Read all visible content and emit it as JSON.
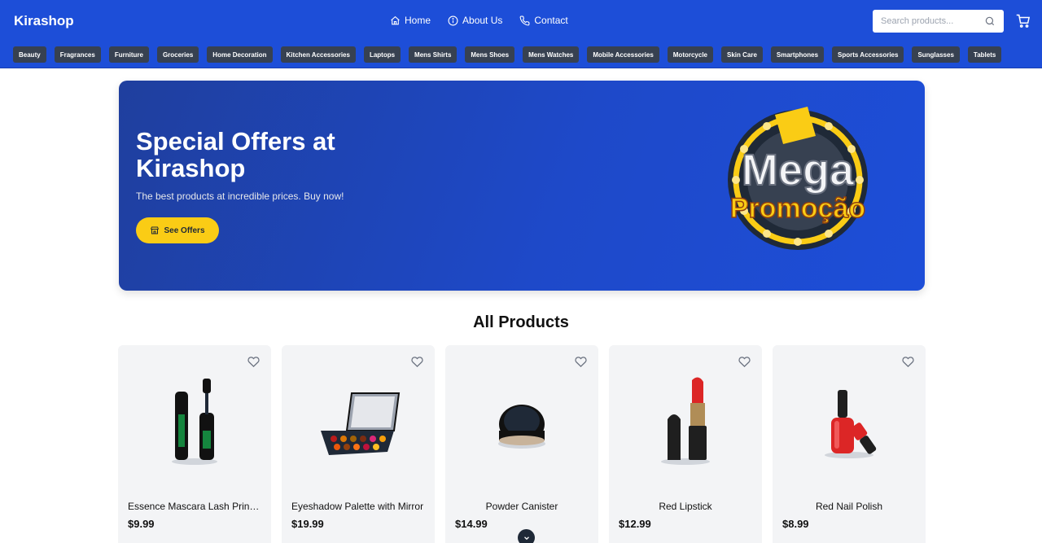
{
  "header": {
    "logo": "Kirashop",
    "nav": [
      {
        "label": "Home",
        "icon": "home-icon"
      },
      {
        "label": "About Us",
        "icon": "info-icon"
      },
      {
        "label": "Contact",
        "icon": "phone-icon"
      }
    ],
    "search_placeholder": "Search products...",
    "categories": [
      "Beauty",
      "Fragrances",
      "Furniture",
      "Groceries",
      "Home Decoration",
      "Kitchen Accessories",
      "Laptops",
      "Mens Shirts",
      "Mens Shoes",
      "Mens Watches",
      "Mobile Accessories",
      "Motorcycle",
      "Skin Care",
      "Smartphones",
      "Sports Accessories",
      "Sunglasses",
      "Tablets"
    ]
  },
  "banner": {
    "title": "Special Offers at Kirashop",
    "subtitle": "The best products at incredible prices. Buy now!",
    "button": "See Offers",
    "promo_line1": "Mega",
    "promo_line2": "Promoção"
  },
  "products_section": {
    "title": "All Products",
    "items": [
      {
        "name": "Essence Mascara Lash Princess",
        "price": "$9.99"
      },
      {
        "name": "Eyeshadow Palette with Mirror",
        "price": "$19.99"
      },
      {
        "name": "Powder Canister",
        "price": "$14.99"
      },
      {
        "name": "Red Lipstick",
        "price": "$12.99"
      },
      {
        "name": "Red Nail Polish",
        "price": "$8.99"
      }
    ]
  },
  "colors": {
    "brand": "#1d4ed8",
    "category_chip": "#374151",
    "accent": "#facc15",
    "card_bg": "#f3f4f6"
  }
}
